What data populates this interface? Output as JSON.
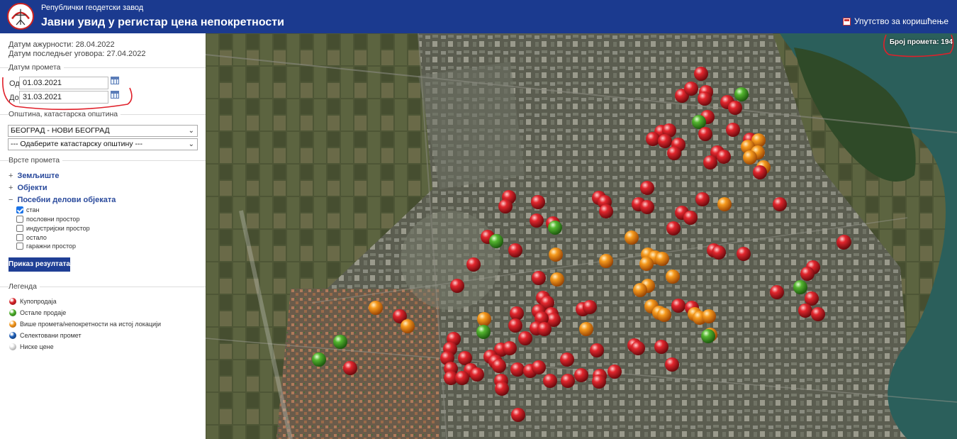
{
  "header": {
    "org_name": "Републички геодетски завод",
    "app_title": "Јавни увид у регистар цена непокретности",
    "help_label": "Упутство за коришћење"
  },
  "sidebar": {
    "update_date": "Датум ажурности: 28.04.2022",
    "last_contract_date": "Датум последњег уговора: 27.04.2022",
    "transaction_date_title": "Датум промета",
    "from_label": "Од:",
    "from_value": "01.03.2021",
    "to_label": "До:",
    "to_value": "31.03.2021",
    "municipality_title": "Општина, катастарска општина",
    "municipality_selected": "БЕОГРАД - НОВИ БЕОГРАД",
    "cadastral_placeholder": "--- Одаберите катастарску општину ---",
    "transaction_types_title": "Врсте промета",
    "tree": [
      {
        "sign": "+",
        "label": "Земљиште"
      },
      {
        "sign": "+",
        "label": "Објекти"
      },
      {
        "sign": "−",
        "label": "Посебни делови објеката"
      }
    ],
    "checkboxes": [
      {
        "label": "стан",
        "checked": true
      },
      {
        "label": "пословни простор",
        "checked": false
      },
      {
        "label": "индустријски простор",
        "checked": false
      },
      {
        "label": "остало",
        "checked": false
      },
      {
        "label": "гаражни простор",
        "checked": false
      }
    ],
    "show_results_label": "Приказ резултата",
    "legend_title": "Легенда",
    "legend": [
      {
        "label": "Купопродаја",
        "color": "#d8232a"
      },
      {
        "label": "Остале продаје",
        "color": "#4caf2a"
      },
      {
        "label": "Више промета/непокретности на истој локацији",
        "color": "#f39a1e"
      },
      {
        "label": "Селектовани промет",
        "color": "#1e5fb8"
      },
      {
        "label": "Ниске цене",
        "color": "#cfcfcf"
      }
    ]
  },
  "map": {
    "transaction_count_label": "Број промета: 194",
    "marker_colors": {
      "red": "#d8232a",
      "green": "#4caf2a",
      "orange": "#f39a1e"
    }
  }
}
